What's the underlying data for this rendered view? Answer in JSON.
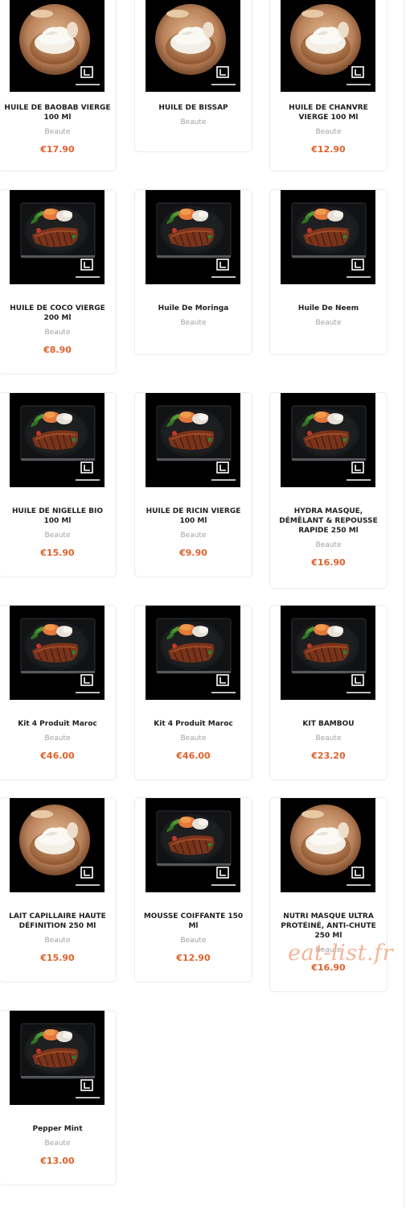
{
  "products": [
    {
      "name": "HUILE DE BAOBAB VIERGE 100 Ml",
      "category": "Beaute",
      "price": "€17.90",
      "image": "cream-bowl"
    },
    {
      "name": "HUILE DE BISSAP",
      "category": "Beaute",
      "price": "",
      "image": "cream-bowl"
    },
    {
      "name": "HUILE DE CHANVRE VIERGE 100 Ml",
      "category": "Beaute",
      "price": "€12.90",
      "image": "cream-bowl"
    },
    {
      "name": "HUILE DE COCO VIERGE 200 Ml",
      "category": "Beaute",
      "price": "€8.90",
      "image": "steak-plate"
    },
    {
      "name": "Huile De Moringa",
      "category": "Beaute",
      "price": "",
      "image": "steak-plate"
    },
    {
      "name": "Huile De Neem",
      "category": "Beaute",
      "price": "",
      "image": "steak-plate"
    },
    {
      "name": "HUILE DE NIGELLE BIO 100 Ml",
      "category": "Beaute",
      "price": "€15.90",
      "image": "steak-plate"
    },
    {
      "name": "HUILE DE RICIN VIERGE 100 Ml",
      "category": "Beaute",
      "price": "€9.90",
      "image": "steak-plate"
    },
    {
      "name": "HYDRA MASQUE, DÉMÊLANT & REPOUSSE RAPIDE 250 Ml",
      "category": "Beaute",
      "price": "€16.90",
      "image": "steak-plate"
    },
    {
      "name": "Kit 4 Produit Maroc",
      "category": "Beaute",
      "price": "€46.00",
      "image": "steak-plate"
    },
    {
      "name": "Kit 4 Produit Maroc",
      "category": "Beaute",
      "price": "€46.00",
      "image": "steak-plate"
    },
    {
      "name": "KIT BAMBOU",
      "category": "Beaute",
      "price": "€23.20",
      "image": "steak-plate"
    },
    {
      "name": "LAIT CAPILLAIRE HAUTE DÉFINITION 250 Ml",
      "category": "Beaute",
      "price": "€15.90",
      "image": "cream-bowl"
    },
    {
      "name": "MOUSSE COIFFANTE 150 Ml",
      "category": "Beaute",
      "price": "€12.90",
      "image": "steak-plate"
    },
    {
      "name": "NUTRI MASQUE ULTRA PROTÉINÉ, ANTI-CHUTE 250 Ml",
      "category": "Beaute",
      "price": "€16.90",
      "image": "cream-bowl"
    },
    {
      "name": "Pepper Mint",
      "category": "Beaute",
      "price": "€13.00",
      "image": "steak-plate"
    }
  ],
  "watermark": "eat-list.fr",
  "colors": {
    "price": "#e0622c",
    "category": "#a2a2a6",
    "name": "#202124",
    "card_border": "#ececf0",
    "watermark": "#f4ad8d"
  }
}
